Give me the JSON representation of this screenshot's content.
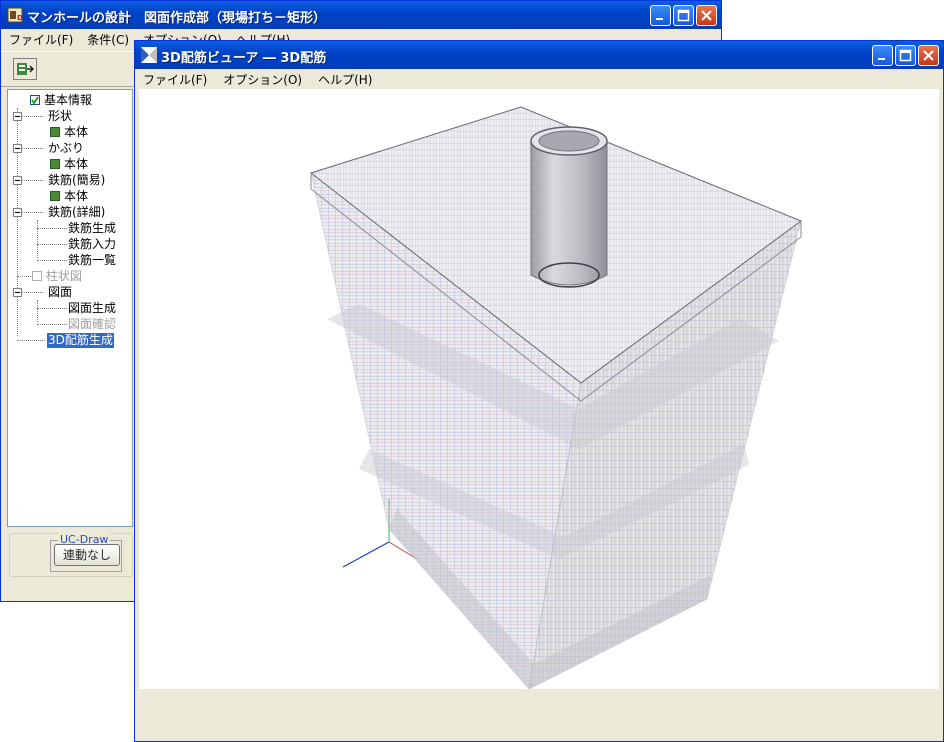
{
  "back_window": {
    "title": "マンホールの設計　図面作成部（現場打ち－矩形）",
    "menu": [
      "ファイル(F)",
      "条件(C)",
      "オプション(O)",
      "ヘルプ(H)"
    ],
    "tree": {
      "root_label": "基本情報",
      "shape": "形状",
      "shape_body": "本体",
      "cover": "かぶり",
      "cover_body": "本体",
      "rebar_simple": "鉄筋(簡易)",
      "rebar_simple_body": "本体",
      "rebar_detail": "鉄筋(詳細)",
      "rebar_generate": "鉄筋生成",
      "rebar_input": "鉄筋入力",
      "rebar_list": "鉄筋一覧",
      "pillar_diagram": "柱状図",
      "drawing": "図面",
      "drawing_generate": "図面生成",
      "drawing_check": "図面確認",
      "rebar3d_generate": "3D配筋生成"
    },
    "ucdraw": {
      "group_label": "UC-Draw",
      "button_label": "連動なし"
    }
  },
  "front_window": {
    "title": "3D配筋ビューア ― 3D配筋",
    "menu": [
      "ファイル(F)",
      "オプション(O)",
      "ヘルプ(H)"
    ]
  },
  "colors": {
    "titlebar": "#0042c8",
    "selection": "#316ac5",
    "check_green": "#4a8a3a",
    "rebar_blue": "#3a4aa8",
    "rebar_pink": "#d88aa8",
    "concrete": "#b8b8c0"
  }
}
